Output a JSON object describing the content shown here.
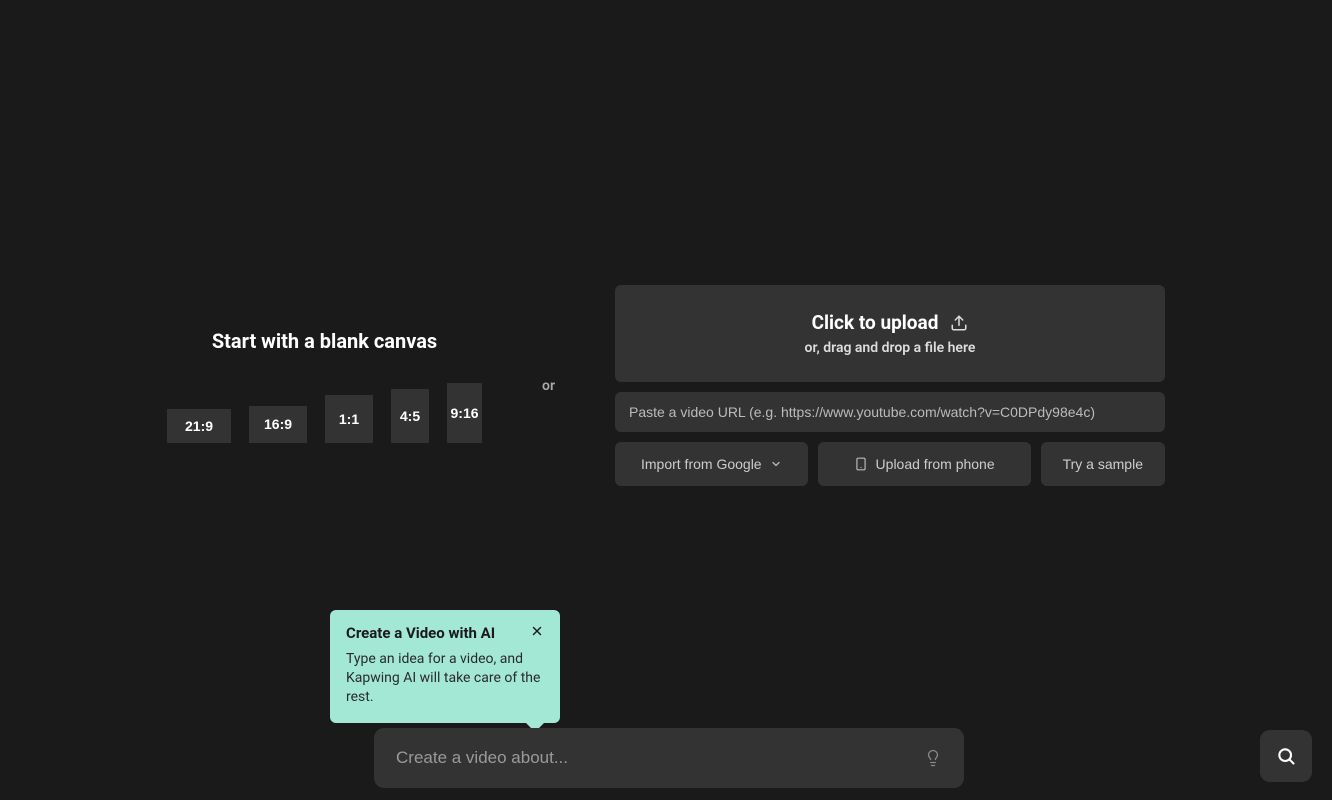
{
  "left": {
    "title": "Start with a blank canvas",
    "ratios": [
      "21:9",
      "16:9",
      "1:1",
      "4:5",
      "9:16"
    ]
  },
  "divider": "or",
  "upload": {
    "title": "Click to upload",
    "subtitle": "or, drag and drop a file here"
  },
  "url_input": {
    "placeholder": "Paste a video URL (e.g. https://www.youtube.com/watch?v=C0DPdy98e4c)"
  },
  "import_buttons": {
    "google": "Import from Google",
    "phone": "Upload from phone",
    "sample": "Try a sample"
  },
  "tooltip": {
    "title": "Create a Video with AI",
    "body": "Type an idea for a video, and Kapwing AI will take care of the rest."
  },
  "prompt": {
    "placeholder": "Create a video about..."
  }
}
